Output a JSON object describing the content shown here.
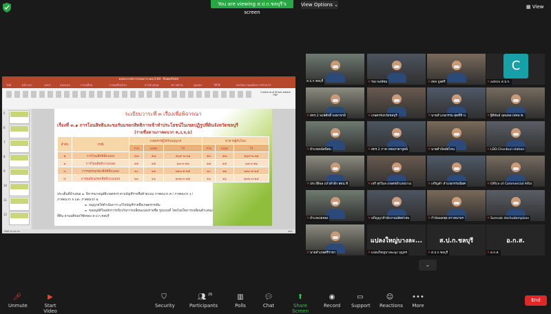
{
  "top": {
    "viewing_banner": "You are viewing ส.ป.ก.ชลบุรี's screen",
    "view_options": "View Options",
    "view_button": "View"
  },
  "ppt": {
    "window_title": "ผลประกาศการกรรมการ เดช 2-64 - PowerPoint",
    "tabs": [
      "ไฟล์",
      "หน้าแรก",
      "แทรก",
      "ออกแบบ",
      "การเปลี่ยน",
      "ภาพเคลื่อนไหว",
      "การนำเสนอ",
      "ตรวจทาน",
      "มุมมอง",
      "วิธีใช้",
      "บอกฉันว่าคุณต้องการทำอะไร"
    ],
    "ribbon_right": "Create and Share Adobe PDF",
    "slide_numbers": [
      "5",
      "6",
      "7",
      "8",
      "9",
      "10",
      "11",
      "12"
    ],
    "status_left": "สไลด์ 10 จาก 31",
    "status_right": "85%"
  },
  "slide": {
    "title": "ระเบียบวาระที่ ๓ เรื่องเพื่อพิจารณา",
    "subtitle": "เรื่องที่ ๓.๑ การโอนสิทธิและขอรับมรดกสิทธิการเข้าทำประโยชน์ในเขตปฏิรูปที่ดินจังหวัดชลบุรี",
    "subtitle2": "(รายชื่อตามภาคผนวก ค,ง,จ,ฉ)",
    "table": {
      "col_order": "ลำดับ",
      "col_case": "กรณี",
      "group1": "เกษตรกรผู้ได้รับอนุญาต",
      "group2": "ทายาทผู้รับโอน",
      "sub": [
        "ราย",
        "แปลง",
        "ไร่",
        "ราย",
        "แปลง",
        "ไร่"
      ],
      "rows": [
        {
          "no": "๑",
          "case": "การโอนสิทธิทั้งแปลง",
          "v": [
            "๔๗",
            "๕๗",
            "๕๖๙-๒-๒๑",
            "๕๓",
            "๕๗",
            "๕๖๙-๒-๒๑"
          ]
        },
        {
          "no": "๒",
          "case": "การโอนสิทธิบางแปลง",
          "v": [
            "๑๕",
            "๑๕",
            "๖๗-๓-๑๒",
            "๑๗",
            "๑๕",
            "๖๗-๓-๑๒"
          ]
        },
        {
          "no": "๓",
          "case": "การขอรับมรดกสิทธิทั้งแปลง",
          "v": [
            "๒๐",
            "๒๑",
            "๒๑๓-๑-๒๕",
            "๒๐",
            "๒๑",
            "๒๑๓-๑-๒๕"
          ]
        },
        {
          "no": "๔",
          "case": "การขอรับมรดกสิทธิบางแปลง",
          "v": [
            "๒๓",
            "๒๖",
            "๑๓๒-๓-๒๕",
            "๒๖",
            "๒๖",
            "๑๓๒-๓-๒๕"
          ]
        }
      ]
    },
    "notes": [
      "ประเด็นที่นำเสนอ ๑. พิจารณาอนุมัติเกษตรกร ตามบัญชีรายชื่อท้ายแบบ ภาคผนวก ค / ภาคผนวก ง /",
      "ภาคผนวก จ และ ภาคผนวก ฉ",
      "๒. อนุญาตให้ดำเนินการ แก้ไขบัญชีรายชื่อเกษตรกรเดิม",
      "๓. ขออนุมัติในหลักการเกี่ยวกับการเปลี่ยนแปลงรายชื่อ รูปแบบที่ โดยไม่เป็นการเปลี่ยนตำแหน่ง",
      "ที่ดิน ตามมติของวิชัยของ ส.ป.ก.ชลบุรี"
    ]
  },
  "participants": [
    {
      "name": "ส.ป.ก.ชลบุรี",
      "active": true,
      "muted": false
    },
    {
      "name": "รอง พงษ์ชม",
      "muted": true
    },
    {
      "name": "สจจ จูลศรี",
      "muted": true
    },
    {
      "name": "admin ส.ป.ก.",
      "muted": true,
      "avatar_letter": "C"
    },
    {
      "name": "สหร.2 พงษ์ศักดิ์ พงษาชายี",
      "muted": true
    },
    {
      "name": "เกษตรจังหวัดชลบุรี",
      "muted": true
    },
    {
      "name": "นายอำเภอกรรม สุดที่ชิ ป.",
      "muted": true
    },
    {
      "name": "ฐิติพันธ์ อุดมพล (ตจพ.ช.",
      "muted": true
    },
    {
      "name": "อำเภอพนัสนิคม",
      "muted": true
    },
    {
      "name": "สหร.2 ภาค กคลภาคาจูพนิ",
      "muted": true
    },
    {
      "name": "นายดำบ์พลัยไหน",
      "muted": true
    },
    {
      "name": "LDD.Chonburi station",
      "muted": true
    },
    {
      "name": "ประวัติพล แก้วสำลีก สตน.ชี",
      "muted": true
    },
    {
      "name": "เจริ สุรวิมล เกษตรอำเภอบางเ",
      "muted": true
    },
    {
      "name": "เจริญดำ อำเภอกรรมนิยศ",
      "muted": true
    },
    {
      "name": "Office of Commercial Affai",
      "muted": true
    },
    {
      "name": "อำเภอบ่อทอง",
      "muted": true
    },
    {
      "name": "อภิญญาสำนักงานปลัดฝ่ายพ",
      "muted": true
    },
    {
      "name": "กำนันพลชุด สวาสนาพร",
      "muted": true
    },
    {
      "name": "Somsak dechudompisan",
      "muted": true
    },
    {
      "name": "นายอำเภอศรีราชา",
      "muted": true
    },
    {
      "name": "แปลงใหญ่บางละมุง บุญทร",
      "muted": true,
      "big_text": "แปลงใหญ่บางละ..."
    },
    {
      "name": "ส.ป.ก.ชลบุรี",
      "muted": true,
      "big_text": "ส.ป.ก.ชลบุรี"
    },
    {
      "name": "อ.ก.ส.",
      "muted": true,
      "big_text": "อ.ก.ส."
    }
  ],
  "scroll_arrow": "⌄",
  "toolbar": {
    "unmute": "Unmute",
    "start_video": "Start Video",
    "security": "Security",
    "participants": "Participants",
    "participant_count": "26",
    "polls": "Polls",
    "chat": "Chat",
    "share_screen": "Share Screen",
    "record": "Record",
    "support": "Support",
    "reactions": "Reactions",
    "more": "More",
    "end": "End"
  },
  "colors": {
    "banner_green": "#29a745",
    "end_red": "#e02828",
    "active_border": "#f5d600",
    "ppt_accent": "#b7472a",
    "share_green": "#2dc84d"
  }
}
